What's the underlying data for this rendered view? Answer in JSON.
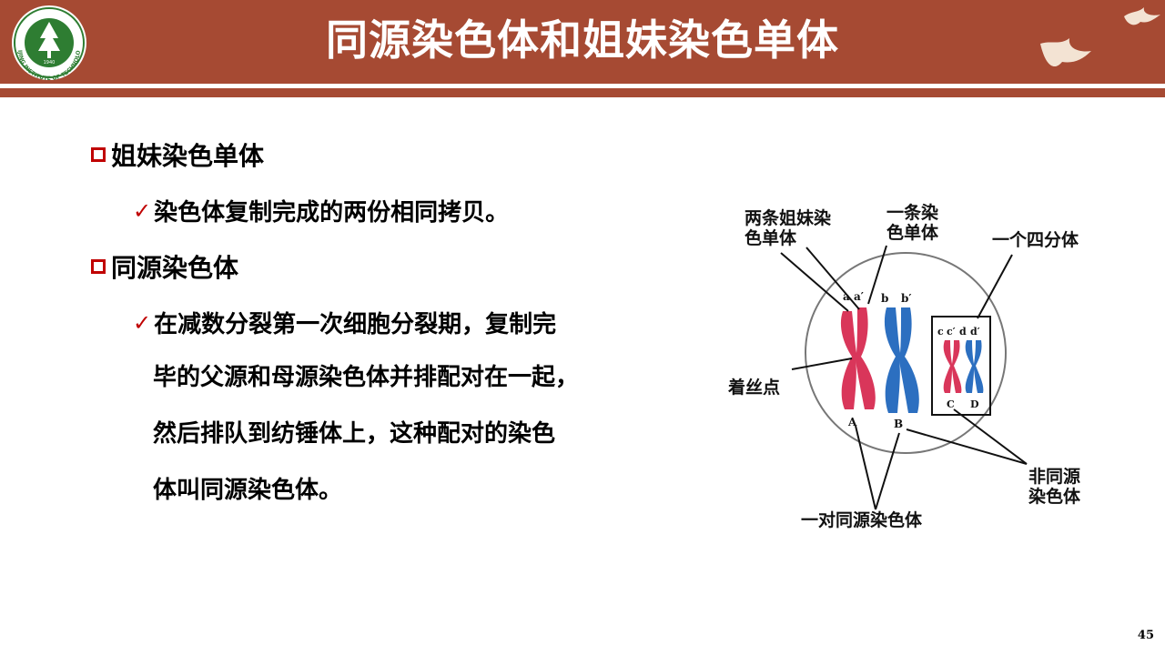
{
  "header": {
    "title": "同源染色体和姐妹染色单体",
    "logo_text": "BEIJING INSTITUTE OF TECHNOLOGY",
    "logo_year": "1940"
  },
  "content": {
    "bullet1": {
      "heading": "姐妹染色单体",
      "detail": "染色体复制完成的两份相同拷贝。"
    },
    "bullet2": {
      "heading": "同源染色体",
      "lines": [
        "在减数分裂第一次细胞分裂期，复制完",
        "毕的父源和母源染色体并排配对在一起，",
        "然后排队到纺锤体上，这种配对的染色",
        "体叫同源染色体。"
      ]
    },
    "check_mark": "✓"
  },
  "figure": {
    "labels": {
      "sister": [
        "两条姐妹染",
        "色单体"
      ],
      "one_chromatid": [
        "一条染",
        "色单体"
      ],
      "tetrad": "一个四分体",
      "centromere": "着丝点",
      "nonhomologous": [
        "非同源",
        "染色体"
      ],
      "homologous_pair": "一对同源染色体"
    },
    "letters": {
      "a": "a",
      "a_prime": "a′",
      "b": "b",
      "b_prime": "b′",
      "c": "c",
      "c_prime": "c′",
      "d": "d",
      "d_prime": "d′",
      "A": "A",
      "B": "B",
      "C": "C",
      "D": "D"
    },
    "colors": {
      "red": "#d9365a",
      "blue": "#2c6fc0"
    }
  },
  "footer": {
    "page_number": "45"
  },
  "colors": {
    "header_bg": "#a64a33",
    "bullet_red": "#c00000"
  }
}
